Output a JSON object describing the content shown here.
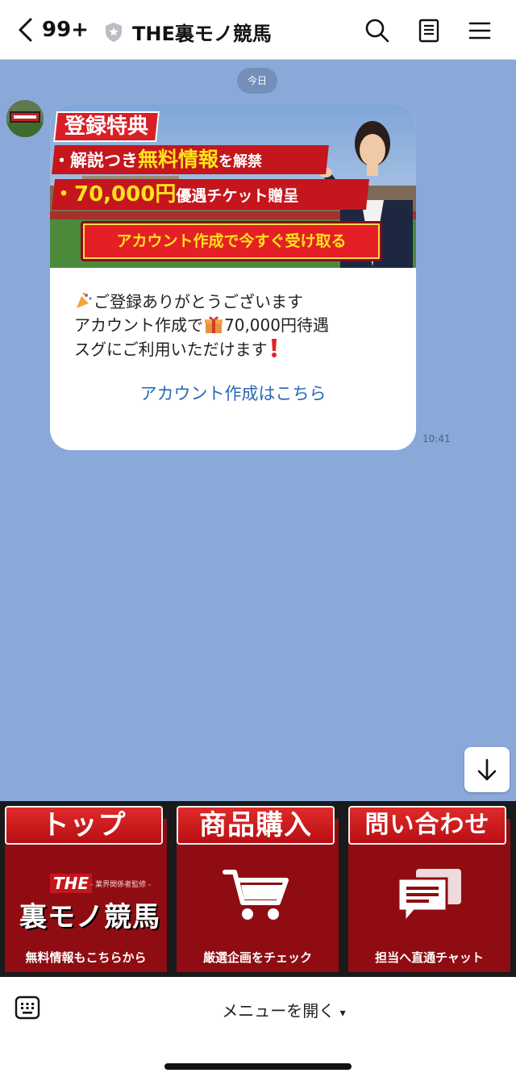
{
  "header": {
    "back_count": "99+",
    "title": "THE裏モノ競馬",
    "icons": [
      "chevron-left-icon",
      "shield-icon",
      "search-icon",
      "note-icon",
      "menu-icon"
    ]
  },
  "chat": {
    "date_label": "今日",
    "banner": {
      "heading": "登録特典",
      "line1_pre": "・解説つき",
      "line1_highlight": "無料情報",
      "line1_post": "を解禁",
      "line2_amount": "・70,000円",
      "line2_post": "優遇チケット贈呈",
      "cta": "アカウント作成で今すぐ受け取る"
    },
    "message": {
      "line1": "ご登録ありがとうございます",
      "line2_pre": "アカウント作成で",
      "line2_post": "70,000円待遇",
      "line3": "スグにご利用いただけます"
    },
    "link_text": "アカウント作成はこちら",
    "timestamp": "10:41"
  },
  "rich_menu": [
    {
      "tab": "トップ",
      "center_the": "THE",
      "center_sub": "- 業界関係者監修 -",
      "center_logo": "裏モノ競馬",
      "caption": "無料情報もこちらから"
    },
    {
      "tab": "商品購入",
      "caption": "厳選企画をチェック"
    },
    {
      "tab": "問い合わせ",
      "caption": "担当へ直通チャット"
    }
  ],
  "bottom_bar": {
    "menu_label": "メニューを開く",
    "menu_caret": "▾"
  },
  "colors": {
    "chat_bg": "#8aa9d9",
    "link": "#2b6ab3",
    "rich_menu_red": "#c0151b",
    "banner_yellow": "#ffe21a"
  }
}
